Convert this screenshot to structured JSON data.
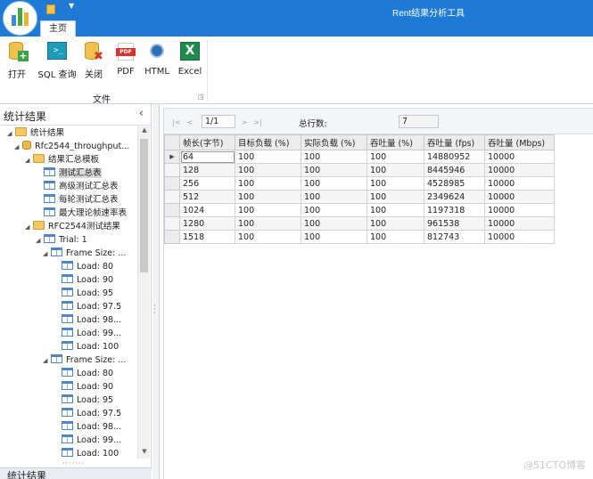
{
  "window": {
    "title": "Rent结果分析工具"
  },
  "ribbon": {
    "tab": "主页",
    "buttons": [
      {
        "id": "open",
        "label": "打开",
        "icon": "open-icon"
      },
      {
        "id": "sql",
        "label": "SQL 查询",
        "icon": "terminal-icon"
      },
      {
        "id": "close",
        "label": "关闭",
        "icon": "close-db-icon"
      },
      {
        "id": "pdf",
        "label": "PDF",
        "icon": "pdf-icon"
      },
      {
        "id": "html",
        "label": "HTML",
        "icon": "html-icon"
      },
      {
        "id": "excel",
        "label": "Excel",
        "icon": "excel-icon"
      }
    ],
    "group_label": "文件"
  },
  "left_panel": {
    "title": "统计结果",
    "footer": "统计结果",
    "tree": [
      {
        "label": "统计结果",
        "icon": "folder",
        "level": 0,
        "expander": "◢"
      },
      {
        "label": "Rfc2544_throughput...",
        "icon": "db",
        "level": 1,
        "expander": "◢"
      },
      {
        "label": "结果汇总模板",
        "icon": "folder",
        "level": 2,
        "expander": "◢"
      },
      {
        "label": "测试汇总表",
        "icon": "table",
        "level": 3,
        "expander": "",
        "selected": true
      },
      {
        "label": "高级测试汇总表",
        "icon": "table",
        "level": 3,
        "expander": ""
      },
      {
        "label": "每轮测试汇总表",
        "icon": "table",
        "level": 3,
        "expander": ""
      },
      {
        "label": "最大理论帧速率表",
        "icon": "table",
        "level": 3,
        "expander": ""
      },
      {
        "label": "RFC2544测试结果",
        "icon": "folder",
        "level": 2,
        "expander": "◢"
      },
      {
        "label": "Trial: 1",
        "icon": "table",
        "level": 3,
        "expander": "◢"
      },
      {
        "label": "Frame Size: ...",
        "icon": "table",
        "level": 4,
        "expander": "◢"
      },
      {
        "label": "Load: 80",
        "icon": "table",
        "level": 5,
        "expander": ""
      },
      {
        "label": "Load: 90",
        "icon": "table",
        "level": 5,
        "expander": ""
      },
      {
        "label": "Load: 95",
        "icon": "table",
        "level": 5,
        "expander": ""
      },
      {
        "label": "Load: 97.5",
        "icon": "table",
        "level": 5,
        "expander": ""
      },
      {
        "label": "Load: 98...",
        "icon": "table",
        "level": 5,
        "expander": ""
      },
      {
        "label": "Load: 99...",
        "icon": "table",
        "level": 5,
        "expander": ""
      },
      {
        "label": "Load: 100",
        "icon": "table",
        "level": 5,
        "expander": ""
      },
      {
        "label": "Frame Size: ...",
        "icon": "table",
        "level": 4,
        "expander": "◢"
      },
      {
        "label": "Load: 80",
        "icon": "table",
        "level": 5,
        "expander": ""
      },
      {
        "label": "Load: 90",
        "icon": "table",
        "level": 5,
        "expander": ""
      },
      {
        "label": "Load: 95",
        "icon": "table",
        "level": 5,
        "expander": ""
      },
      {
        "label": "Load: 97.5",
        "icon": "table",
        "level": 5,
        "expander": ""
      },
      {
        "label": "Load: 98...",
        "icon": "table",
        "level": 5,
        "expander": ""
      },
      {
        "label": "Load: 99...",
        "icon": "table",
        "level": 5,
        "expander": ""
      },
      {
        "label": "Load: 100",
        "icon": "table",
        "level": 5,
        "expander": ""
      }
    ]
  },
  "pager": {
    "first": "|<",
    "prev": "<",
    "page": "1/1",
    "next": ">",
    "last": ">|",
    "total_label": "总行数:",
    "total": "7"
  },
  "grid": {
    "columns": [
      "帧长(字节)",
      "目标负载 (%)",
      "实际负载 (%)",
      "吞吐量 (%)",
      "吞吐量 (fps)",
      "吞吐量 (Mbps)"
    ],
    "rows": [
      [
        "64",
        "100",
        "100",
        "100",
        "14880952",
        "10000"
      ],
      [
        "128",
        "100",
        "100",
        "100",
        "8445946",
        "10000"
      ],
      [
        "256",
        "100",
        "100",
        "100",
        "4528985",
        "10000"
      ],
      [
        "512",
        "100",
        "100",
        "100",
        "2349624",
        "10000"
      ],
      [
        "1024",
        "100",
        "100",
        "100",
        "1197318",
        "10000"
      ],
      [
        "1280",
        "100",
        "100",
        "100",
        "961538",
        "10000"
      ],
      [
        "1518",
        "100",
        "100",
        "100",
        "812743",
        "10000"
      ]
    ],
    "current_row_marker": "▶"
  },
  "watermark": "@51CTO博客",
  "colors": {
    "titlebar": "#1f7ad6",
    "selection": "#d8d8d8"
  }
}
